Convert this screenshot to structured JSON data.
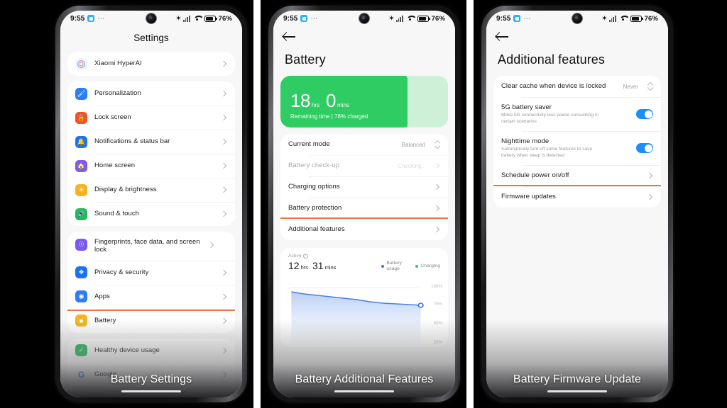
{
  "status_bar": {
    "time": "9:55",
    "battery_percent": "76%",
    "icons": [
      "calendar-chip",
      "more-dots",
      "bluetooth-icon",
      "signal-icon",
      "wifi-icon",
      "battery-icon"
    ]
  },
  "colors": {
    "highlight": "#ef7541",
    "toggle_on": "#1b8ef8",
    "battery_green": "#2ecc62",
    "battery_green_track": "#cdf0d6",
    "chart_blue": "#4a7fe0",
    "charging_green": "#2ecc62"
  },
  "panels": [
    {
      "caption": "Battery Settings",
      "screen_title": "Settings",
      "groups": [
        {
          "items": [
            {
              "label": "Xiaomi HyperAI",
              "icon": "hyperai-icon",
              "icon_color": "#ffffff",
              "chevron": true
            }
          ]
        },
        {
          "items": [
            {
              "label": "Personalization",
              "icon": "brush-icon",
              "icon_color": "#2b7cf6",
              "chevron": true
            },
            {
              "label": "Lock screen",
              "icon": "lock-icon",
              "icon_color": "#f0522a",
              "chevron": true
            },
            {
              "label": "Notifications & status bar",
              "icon": "bell-icon",
              "icon_color": "#1a73f0",
              "chevron": true
            },
            {
              "label": "Home screen",
              "icon": "home-icon",
              "icon_color": "#7c5cf0",
              "chevron": true
            },
            {
              "label": "Display & brightness",
              "icon": "sun-icon",
              "icon_color": "#f5b323",
              "chevron": true
            },
            {
              "label": "Sound & touch",
              "icon": "speaker-icon",
              "icon_color": "#22b85c",
              "chevron": true
            }
          ]
        },
        {
          "items": [
            {
              "label": "Fingerprints, face data, and screen lock",
              "icon": "fingerprint-icon",
              "icon_color": "#7a5af0",
              "chevron": true
            },
            {
              "label": "Privacy & security",
              "icon": "shield-icon",
              "icon_color": "#1a73f0",
              "chevron": true
            },
            {
              "label": "Apps",
              "icon": "apps-icon",
              "icon_color": "#2b7cf6",
              "chevron": true
            },
            {
              "label": "Battery",
              "icon": "battery-icon",
              "icon_color": "#f5b323",
              "chevron": true,
              "highlighted": true
            }
          ]
        },
        {
          "items": [
            {
              "label": "Healthy device usage",
              "icon": "heart-shield-icon",
              "icon_color": "#22b85c",
              "chevron": true
            },
            {
              "label": "Google",
              "icon": "google-icon",
              "icon_color": "#ffffff",
              "chevron": true
            }
          ]
        }
      ]
    },
    {
      "caption": "Battery Additional Features",
      "screen_title": "Battery",
      "hero": {
        "hours": "18",
        "hours_unit": "hrs",
        "minutes": "0",
        "minutes_unit": "mins",
        "subtitle": "Remaining time | 76% charged",
        "fill_percent": 76
      },
      "items": [
        {
          "label": "Current mode",
          "value": "Balanced",
          "control": "stepper"
        },
        {
          "label": "Battery check-up",
          "value": "Checking..",
          "control": "chevron",
          "dimmed": true
        },
        {
          "label": "Charging options",
          "control": "chevron"
        },
        {
          "label": "Battery protection",
          "control": "chevron"
        },
        {
          "label": "Additional features",
          "control": "chevron",
          "highlighted": true
        }
      ],
      "usage": {
        "active_label": "Active",
        "hours": "12",
        "hours_unit": "hrs",
        "minutes": "31",
        "minutes_unit": "mins",
        "legend": [
          {
            "label": "Battery usage",
            "color": "#2b7cf6"
          },
          {
            "label": "Charging",
            "color": "#2ecc62"
          }
        ]
      }
    },
    {
      "caption": "Battery Firmware Update",
      "screen_title": "Additional features",
      "items": [
        {
          "label": "Clear cache when device is locked",
          "value": "Never",
          "control": "stepper"
        },
        {
          "label": "5G battery saver",
          "sub": "Make 5G connectivity less power consuming in certain scenarios",
          "control": "toggle",
          "toggle_on": true
        },
        {
          "label": "Nighttime mode",
          "sub": "Automatically turn off some features to save battery when sleep is detected",
          "control": "toggle",
          "toggle_on": true
        },
        {
          "label": "Schedule power on/off",
          "control": "chevron"
        },
        {
          "label": "Firmware updates",
          "control": "chevron",
          "highlighted": true
        }
      ]
    }
  ],
  "chart_data": {
    "type": "area",
    "title": "Battery usage",
    "xlabel": "",
    "ylabel": "",
    "ylim": [
      25,
      100
    ],
    "yticks": [
      100,
      75,
      50,
      25
    ],
    "ytick_labels": [
      "100%",
      "75%",
      "50%",
      "25%"
    ],
    "grid": false,
    "x": [
      0,
      1,
      2,
      3,
      4,
      5,
      6,
      7,
      8,
      9,
      10
    ],
    "series": [
      {
        "name": "Battery usage",
        "color": "#4a7fe0",
        "values": [
          90,
          87,
          85,
          84,
          83,
          82,
          80,
          79,
          78,
          77,
          76
        ]
      },
      {
        "name": "Charging",
        "color": "#2ecc62",
        "values": []
      }
    ],
    "last_point": {
      "x": 10,
      "y": 76,
      "marker": "circle"
    },
    "legend_position": "top-right"
  }
}
